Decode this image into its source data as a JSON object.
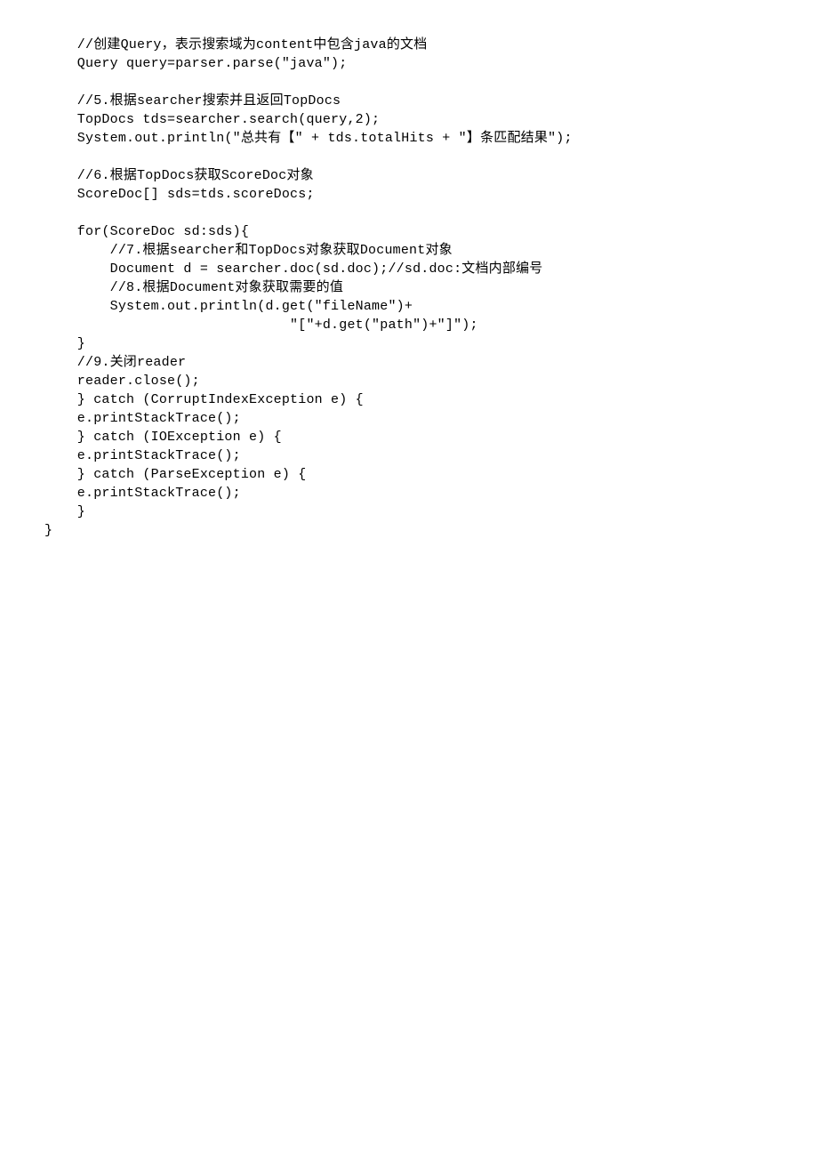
{
  "code": {
    "lines": [
      "    //创建Query，表示搜索域为content中包含java的文档",
      "    Query query=parser.parse(\"java\");",
      "",
      "    //5.根据searcher搜索并且返回TopDocs",
      "    TopDocs tds=searcher.search(query,2);",
      "    System.out.println(\"总共有【\" + tds.totalHits + \"】条匹配结果\");",
      "",
      "    //6.根据TopDocs获取ScoreDoc对象",
      "    ScoreDoc[] sds=tds.scoreDocs;",
      "",
      "    for(ScoreDoc sd:sds){",
      "        //7.根据searcher和TopDocs对象获取Document对象",
      "        Document d = searcher.doc(sd.doc);//sd.doc:文档内部编号",
      "        //8.根据Document对象获取需要的值",
      "        System.out.println(d.get(\"fileName\")+",
      "                              \"[\"+d.get(\"path\")+\"]\");",
      "    }",
      "    //9.关闭reader",
      "    reader.close();",
      "    } catch (CorruptIndexException e) {",
      "    e.printStackTrace();",
      "    } catch (IOException e) {",
      "    e.printStackTrace();",
      "    } catch (ParseException e) {",
      "    e.printStackTrace();",
      "    }",
      "}"
    ]
  }
}
